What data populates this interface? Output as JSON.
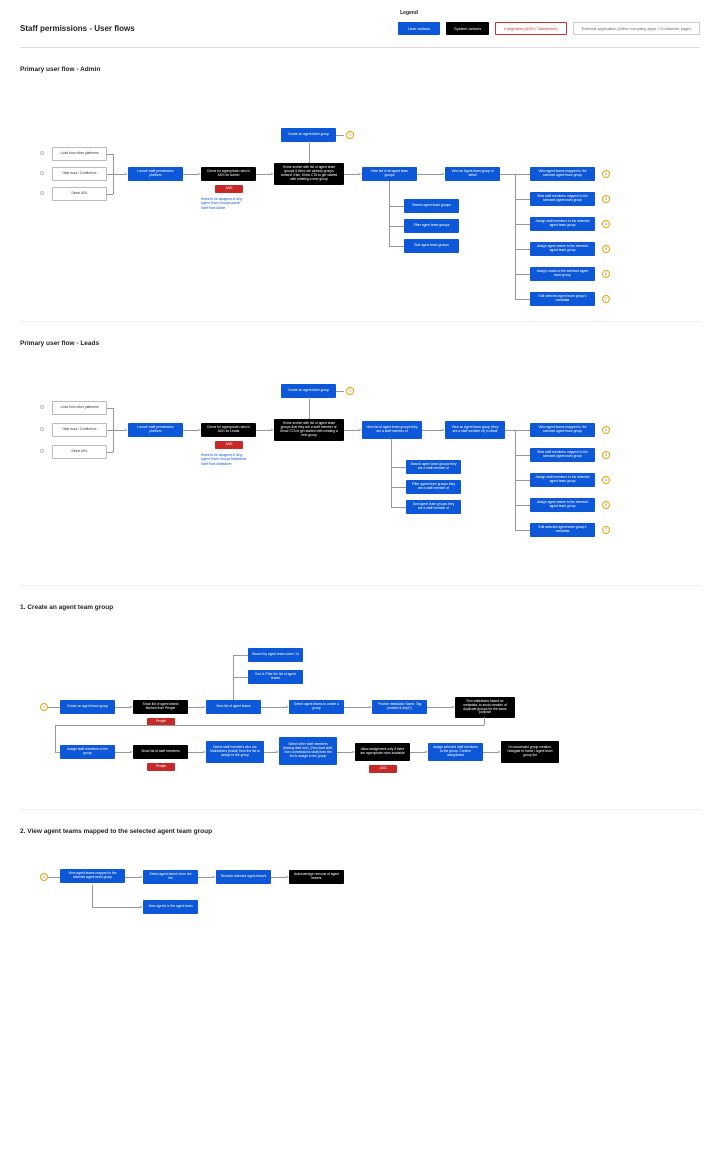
{
  "title": "Staff permissions - User flows",
  "legend": {
    "title": "Legend",
    "items": {
      "user": "User actions",
      "system": "System actions",
      "integration": "Integration (ASG / Salesforce)",
      "external": "External application (Other company apps / Confluence page)"
    }
  },
  "sections": {
    "admin": {
      "title": "Primary user flow - Admin",
      "entries": {
        "e1": "Links from other platforms",
        "e2": "Help docs / Confluence",
        "e3": "Direct URL"
      },
      "nodes": {
        "launch": "Launch staff permissions platform",
        "check": "Check for appropriate roles in ASG for Admin",
        "asg": "ASG",
        "note": "Roles to be assigned in a2g:\nAgent Team Groups Admin\nStaff Role Admin",
        "home": "Home screen with list of agent team groups if there are already groups created. Else, Show CTA to get started with creating a new group",
        "create": "Create an agent team group",
        "viewlist": "View list of all agent team groups",
        "viewdetail": "View an Agent team group in detail",
        "search": "Search agent team groups",
        "filter": "Filter agent team groups",
        "sort": "Sort agent team groups",
        "r1": "View agent teams mapped to the selected agent team group",
        "r2": "View staff members mapped to the selected agent team group",
        "r3": "Assign staff members to the selected agent team group",
        "r4": "Assign agent teams to the selected agent team group",
        "r5": "Assign Leads to the selected agent team group",
        "r6": "Edit selected agent team group's metadata"
      }
    },
    "leads": {
      "title": "Primary user flow - Leads",
      "entries": {
        "e1": "Links from other platforms",
        "e2": "Help docs / Confluence",
        "e3": "Direct URL"
      },
      "nodes": {
        "launch": "Launch staff permissions platform",
        "check": "Check for appropriate roles in ASG for Leads",
        "asg": "ASG",
        "note": "Roles to be assigned in a2g:\nAgent Team Groups Maintainer\nStaff Role Maintainer",
        "home": "Home screen with list of agent team groups that they are a staff member of. Show CTA to get started with creating a new group",
        "create": "Create an agent team group",
        "viewlist": "View list of agent team groups they are a staff member of",
        "viewdetail": "View an Agent team group (they are a staff member of) in detail",
        "search": "Search agent team groups they are a staff member of",
        "filter": "Filter agent team groups they are a staff member of",
        "sort": "Sort agent team groups they are a staff member of",
        "r1": "View agent teams mapped to the selected agent team group",
        "r2": "View staff members mapped to the selected agent team group",
        "r3": "Assign staff members to the selected agent team group",
        "r4": "Assign agent teams to the selected agent team group",
        "r5": "Edit selected agent team group's metadata"
      }
    },
    "create": {
      "title": "1. Create an agent team group",
      "nodes": {
        "start": "Create an agent team group",
        "showlist": "Show list of agent teams fetched from People",
        "people1": "People",
        "viewlist": "View list of agent teams",
        "search": "Search by agent team name / id",
        "sortfilter": "Sort & Filter the list of agent teams",
        "select": "Select agent teams to create a group",
        "metadata": "Provide metadata: Name, Tag (market & dept?)",
        "validate": "Run validations based on metadata, to avoid creation of duplicate groups for the same purpose",
        "assign": "Assign staff members to the group",
        "showstaff": "Show list of staff members",
        "people2": "People",
        "selectstaff": "Select staff members who are Maintainers (leads) from the list to assign to the group",
        "selectother": "Select other staff members (having staff role). (Non-lead staff, Non commissions staff) from the list to assign to the group",
        "allow": "Allow assignment only if there are appropriate roles available",
        "asg": "ASG",
        "confirm": "Assign selected staff members to the group. Confirm assignment",
        "success": "On successful group creation, Navigate to home / Agent team group list"
      }
    },
    "view": {
      "title": "2. View agent teams mapped to the selected agent team group",
      "nodes": {
        "start": "View agent teams mapped to the selected agent team group",
        "select": "Select agent team/s from the list",
        "remove": "Remove selected agent team/s",
        "ack": "Acknowledge removal of agent team/s",
        "viewagents": "View agents in the agent team"
      }
    }
  }
}
